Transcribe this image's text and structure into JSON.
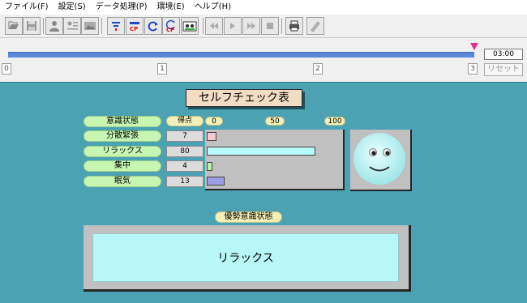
{
  "menu": [
    "ファイル(F)",
    "設定(S)",
    "データ処理(P)",
    "環境(E)",
    "ヘルプ(H)"
  ],
  "toolbar": {
    "buttons": [
      "open-icon",
      "save-icon",
      "user-icon",
      "user-list-icon",
      "image-icon",
      "filter-icon",
      "cp-red-icon",
      "refresh-icon",
      "cp-refresh-icon",
      "tape-icon",
      "rewind-icon",
      "play-icon",
      "fast-forward-icon",
      "stop-icon",
      "print-icon",
      "help-pen-icon"
    ]
  },
  "timeline": {
    "ticks": [
      "0",
      "1",
      "2",
      "3"
    ],
    "time": "03:00",
    "reset_label": "リセット"
  },
  "chart_header": {
    "title": "セルフチェック表",
    "state_header": "意識状態",
    "score_header": "得点",
    "scale": [
      "0",
      "50",
      "100"
    ]
  },
  "rows": [
    {
      "label": "分散緊張",
      "score": "7",
      "value": 7,
      "color": "#f5c7cf"
    },
    {
      "label": "リラックス",
      "score": "80",
      "value": 80,
      "color": "#b7fbfb"
    },
    {
      "label": "集中",
      "score": "4",
      "value": 4,
      "color": "#b8f2a2"
    },
    {
      "label": "眠気",
      "score": "13",
      "value": 13,
      "color": "#9e9ee8"
    }
  ],
  "face": {
    "icon": "smiley-face-icon",
    "color": "#bdf3f3"
  },
  "dominant": {
    "label": "優勢意識状態",
    "value": "リラックス"
  }
}
